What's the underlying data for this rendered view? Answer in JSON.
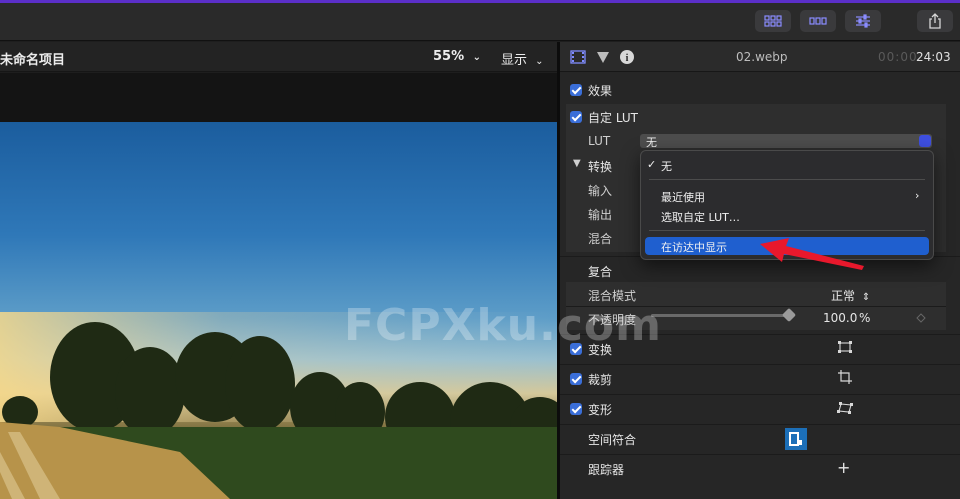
{
  "viewer": {
    "project_title": "未命名项目",
    "zoom": "55%",
    "display_menu": "显示"
  },
  "inspector": {
    "clip_name": "02.webp",
    "timecode_dim": "00:00",
    "timecode": "24:03",
    "effects_label": "效果",
    "lut_section": {
      "title": "自定 LUT",
      "lut_label": "LUT",
      "lut_value": "无",
      "convert_label": "转换",
      "input_label": "输入",
      "output_label": "输出",
      "mix_label": "混合"
    },
    "composite": {
      "title": "复合",
      "blend_mode_label": "混合模式",
      "blend_mode_value": "正常",
      "opacity_label": "不透明度",
      "opacity_value": "100.0",
      "opacity_unit": "%",
      "opacity_level": 1.0
    },
    "transform_label": "变换",
    "crop_label": "裁剪",
    "distort_label": "变形",
    "spatial_label": "空间符合",
    "tracker_label": "跟踪器"
  },
  "dropdown": {
    "none_item": "无",
    "recent_item": "最近使用",
    "choose_item": "选取自定 LUT…",
    "reveal_item": "在访达中显示"
  },
  "watermark": "FCPXku.com",
  "colors": {
    "accent_purple": "#5b2fc9",
    "checkbox_blue": "#3a6ed8",
    "menu_highlight": "#1f5fcf",
    "arrow_red": "#e8182c"
  }
}
